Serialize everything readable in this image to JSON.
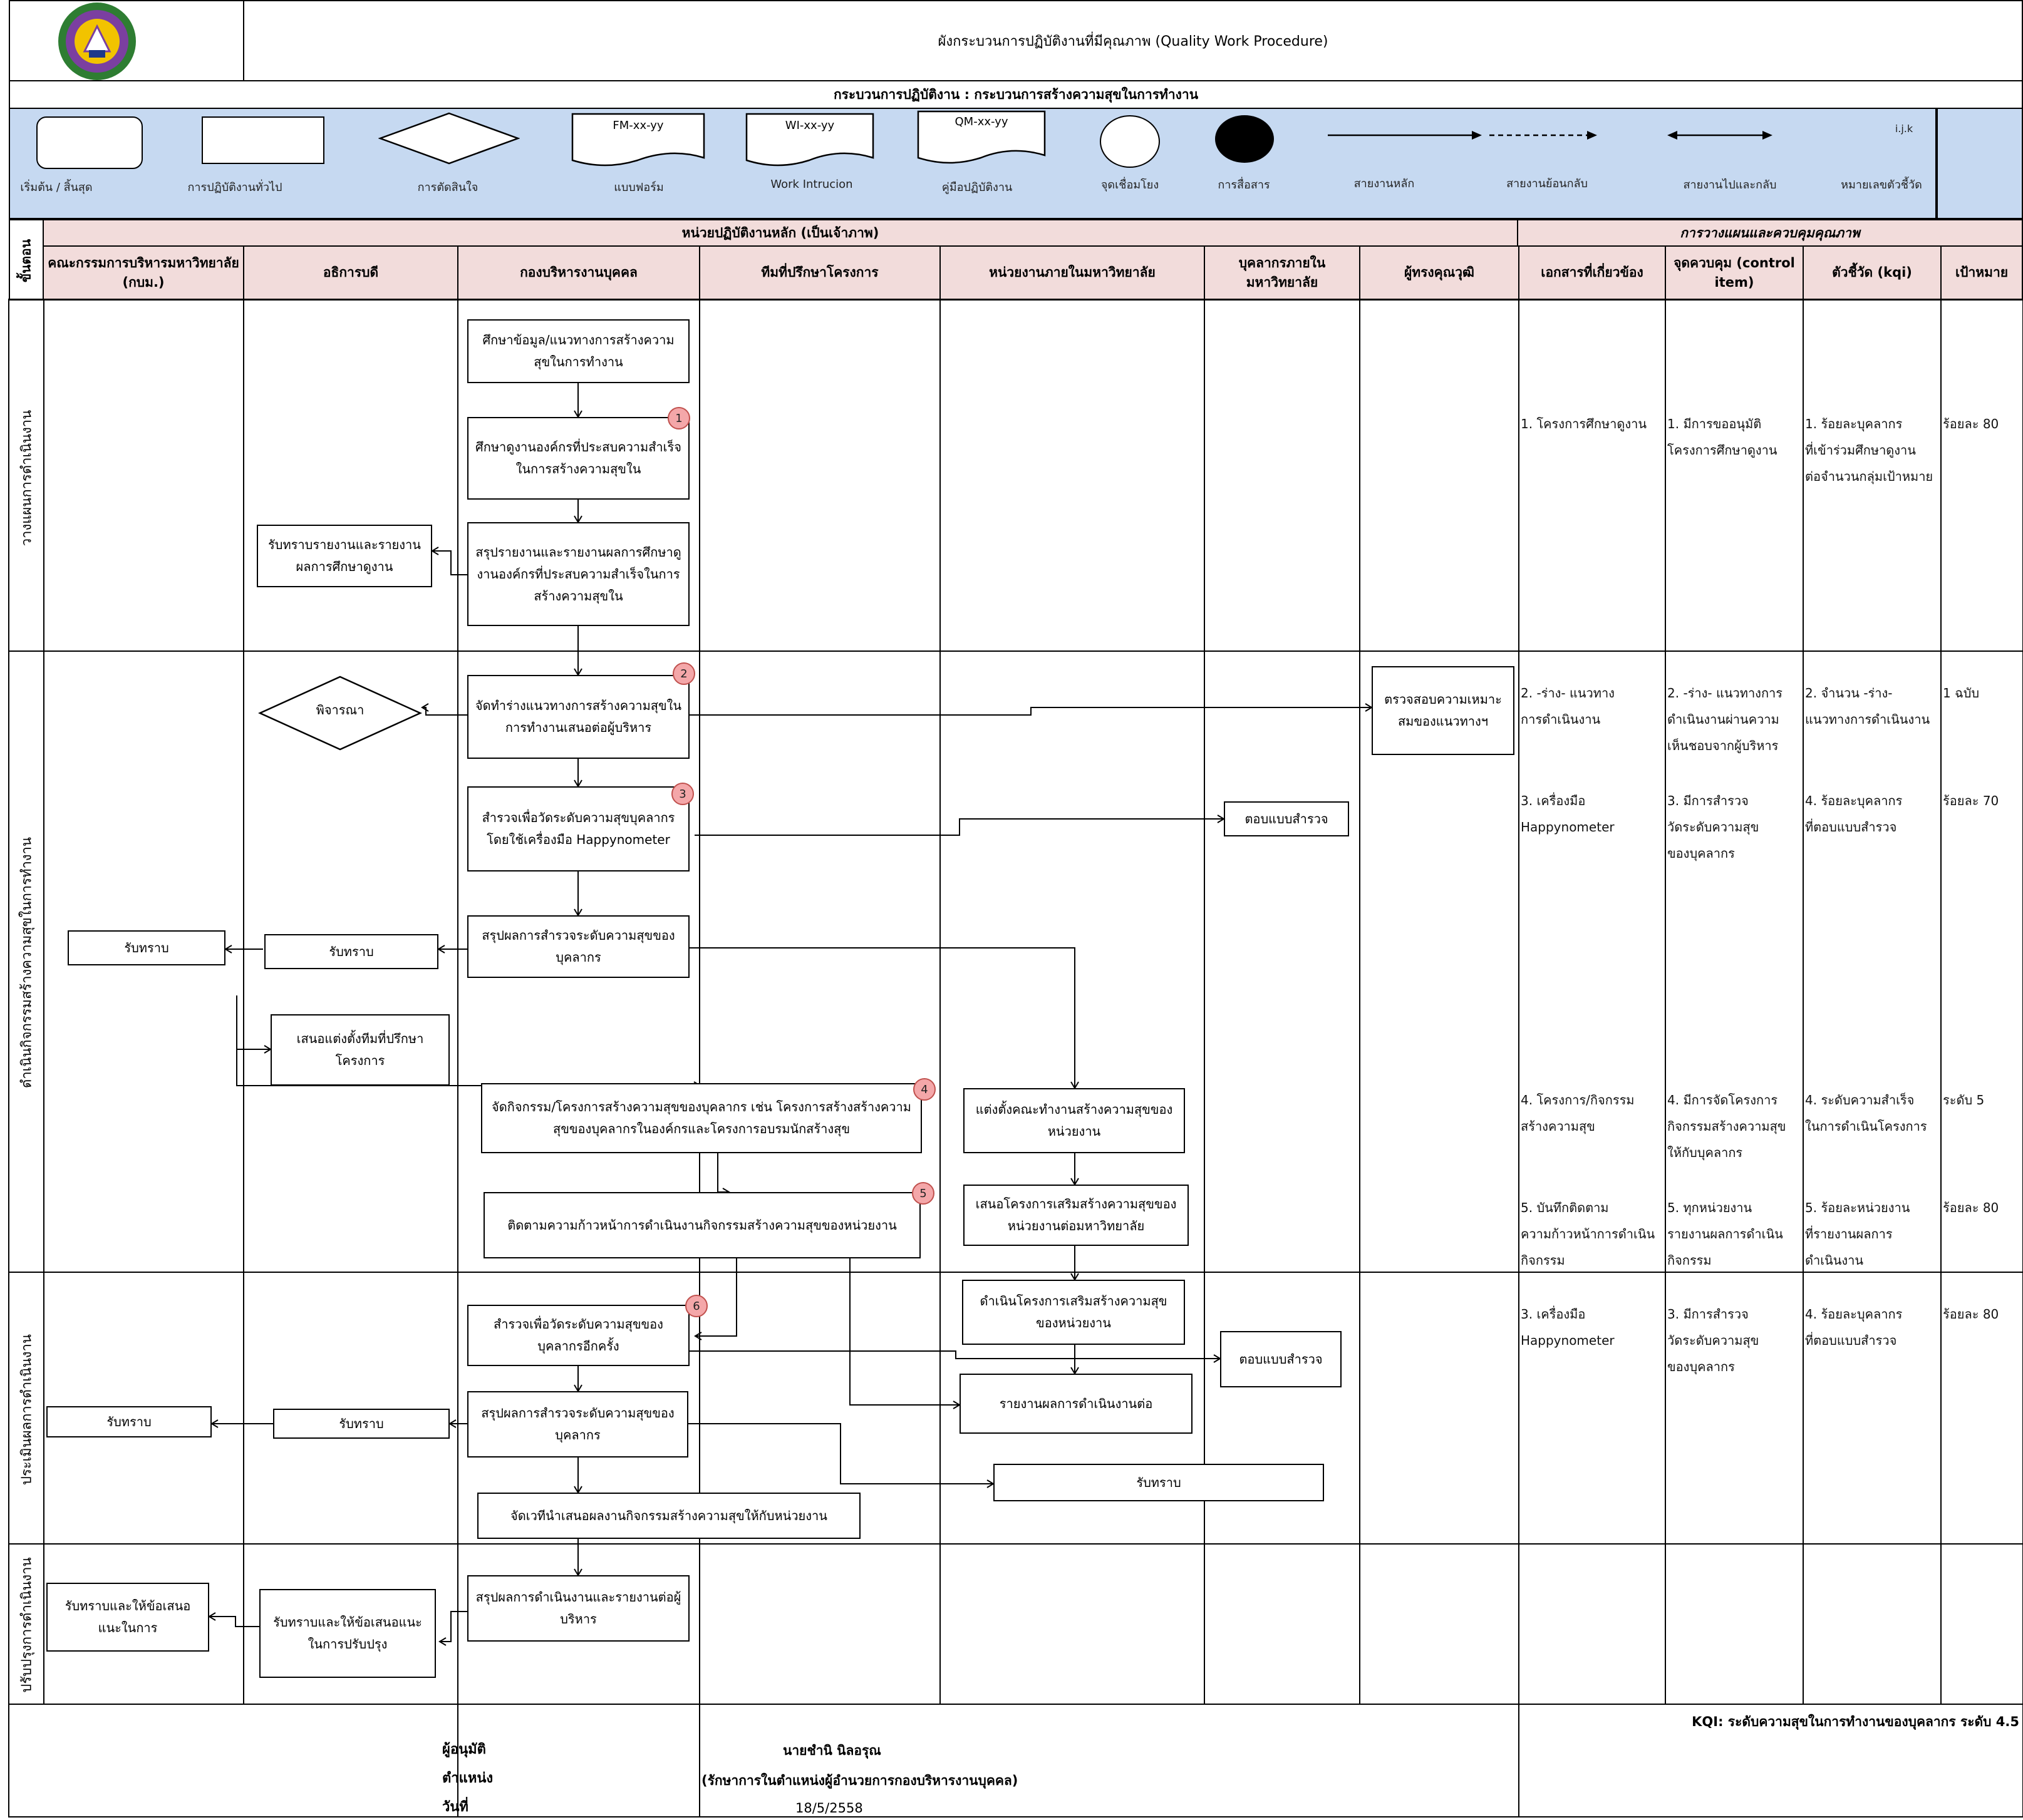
{
  "header": {
    "title": "ผังกระบวนการปฏิบัติงานที่มีคุณภาพ (Quality Work Procedure)",
    "process": "กระบวนการปฏิบัติงาน : กระบวนการสร้างความสุขในการทำงาน"
  },
  "legend": {
    "start_end": "เริ่มต้น / สิ้นสุด",
    "general": "การปฏิบัติงานทั่วไป",
    "decision": "การตัดสินใจ",
    "form": "แบบฟอร์ม",
    "form_code": "FM-xx-yy",
    "wi": "Work Intrucion",
    "wi_code": "WI-xx-yy",
    "manual": "คู่มือปฏิบัติงาน",
    "manual_code": "QM-xx-yy",
    "connector": "จุดเชื่อมโยง",
    "communication": "การสื่อสาร",
    "main_line": "สายงานหลัก",
    "return_line": "สายงานย้อนกลับ",
    "both_line": "สายงานไปและกลับ",
    "indicator": "หมายเลขตัวชี้วัด",
    "indicator_code": "i.j.k"
  },
  "table": {
    "step_head": "ขั้นตอน",
    "main_group": "หน่วยปฏิบัติงานหลัก (เป็นเจ้าภาพ)",
    "qc_group": "การวางแผนและควบคุมคุณภาพ",
    "columns": [
      "คณะกรรมการบริหารมหาวิทยาลัย (กบม.)",
      "อธิการบดี",
      "กองบริหารงานบุคคล",
      "ทีมที่ปรึกษาโครงการ",
      "หน่วยงานภายในมหาวิทยาลัย",
      "บุคลากรภายใน มหาวิทยาลัย",
      "ผู้ทรงคุณวุฒิ",
      "เอกสารที่เกี่ยวข้อง",
      "จุดควบคุม (control item)",
      "ตัวชี้วัด (kqi)",
      "เป้าหมาย"
    ],
    "phases": [
      "วางแผนการดำเนินงาน",
      "ดำเนินกิจกรรมสร้างความสุขในการทำงาน",
      "ประเมินผลการดำเนินงาน",
      "ปรับปรุงการดำเนินงาน"
    ]
  },
  "boxes": {
    "b1": "ศึกษาข้อมูล/แนวทางการสร้างความสุขในการทำงาน",
    "b2": "ศึกษาดูงานองค์กรที่ประสบความสำเร็จในการสร้างความสุขใน",
    "b3": "สรุปรายงานและรายงานผลการศึกษาดูงานองค์กรที่ประสบความสำเร็จในการสร้างความสุขใน",
    "b4": "รับทราบรายงานและรายงานผลการศึกษาดูงาน",
    "b5": "จัดทำร่างแนวทางการสร้างความสุขในการทำงานเสนอต่อผู้บริหาร",
    "b6": "พิจารณา",
    "b7": "ตรวจสอบความเหมาะสมของแนวทางฯ",
    "b8": "สำรวจเพื่อวัดระดับความสุขบุคลากรโดยใช้เครื่องมือ Happynometer",
    "b9": "ตอบแบบสำรวจ",
    "b10": "สรุปผลการสำรวจระดับความสุขของบุคลากร",
    "b11": "รับทราบ",
    "b12": "รับทราบ",
    "b13": "เสนอแต่งตั้งทีมที่ปรึกษาโครงการ",
    "b14": "จัดกิจกรรม/โครงการสร้างความสุขของบุคลากร เช่น โครงการสร้างสร้างความสุขของบุคลากรในองค์กรและโครงการอบรมนักสร้างสุข",
    "b15": "แต่งตั้งคณะทำงานสร้างความสุขของหน่วยงาน",
    "b16": "ติดตามความก้าวหน้าการดำเนินงานกิจกรรมสร้างความสุขของหน่วยงาน",
    "b17": "เสนอโครงการเสริมสร้างความสุขของหน่วยงานต่อมหาวิทยาลัย",
    "b18": "ดำเนินโครงการเสริมสร้างความสุขของหน่วยงาน",
    "b19": "สำรวจเพื่อวัดระดับความสุขของบุคลากรอีกครั้ง",
    "b20": "ตอบแบบสำรวจ",
    "b21": "รายงานผลการดำเนินงานต่อ",
    "b22": "สรุปผลการสำรวจระดับความสุขของบุคลากร",
    "b23": "รับทราบ",
    "b24": "รับทราบ",
    "b25": "รับทราบ",
    "b26": "จัดเวทีนำเสนอผลงานกิจกรรมสร้างความสุขให้กับหน่วยงาน",
    "b27": "สรุปผลการดำเนินงานและรายงานต่อผู้บริหาร",
    "b28": "รับทราบและให้ข้อเสนอแนะในการปรับปรุง",
    "b29": "รับทราบและให้ข้อเสนอแนะในการ"
  },
  "markers": [
    "1",
    "2",
    "3",
    "4",
    "5",
    "6"
  ],
  "quality_rows": [
    {
      "doc": "1. โครงการศึกษาดูงาน",
      "control": "1. มีการขออนุมัติ\nโครงการศึกษาดูงาน",
      "kqi": "1. ร้อยละบุคลากร\nที่เข้าร่วมศึกษาดูงาน\nต่อจำนวนกลุ่มเป้าหมาย",
      "target": "ร้อยละ 80"
    },
    {
      "doc": "2. -ร่าง- แนวทาง\nการดำเนินงาน",
      "control": "2. -ร่าง- แนวทางการ\nดำเนินงานผ่านความ\nเห็นชอบจากผู้บริหาร",
      "kqi": "2. จำนวน -ร่าง-\nแนวทางการดำเนินงาน",
      "target": "1 ฉบับ"
    },
    {
      "doc": "3. เครื่องมือ\nHappynometer",
      "control": "3. มีการสำรวจ\nวัดระดับความสุข\nของบุคลากร",
      "kqi": "4. ร้อยละบุคลากร\nที่ตอบแบบสำรวจ",
      "target": "ร้อยละ 70"
    },
    {
      "doc": "4. โครงการ/กิจกรรม\nสร้างความสุข",
      "control": "4. มีการจัดโครงการ\nกิจกรรมสร้างความสุข\nให้กับบุคลากร",
      "kqi": "4. ระดับความสำเร็จ\nในการดำเนินโครงการ",
      "target": "ระดับ 5"
    },
    {
      "doc": "5. บันทึกติดตาม\nความก้าวหน้าการดำเนิน\nกิจกรรม",
      "control": "5. ทุกหน่วยงาน\nรายงานผลการดำเนิน\nกิจกรรม",
      "kqi": "5. ร้อยละหน่วยงาน\nที่รายงานผลการ\nดำเนินงาน",
      "target": "ร้อยละ 80"
    },
    {
      "doc": "3. เครื่องมือ\nHappynometer",
      "control": "3. มีการสำรวจ\nวัดระดับความสุข\nของบุคลากร",
      "kqi": "4. ร้อยละบุคลากร\nที่ตอบแบบสำรวจ",
      "target": "ร้อยละ 80"
    }
  ],
  "kqi_summary": "KQI: ระดับความสุขในการทำงานของบุคลากร ระดับ 4.5",
  "footer": {
    "approver_label": "ผู้อนุมัติ",
    "approver_name": "นายชำนิ  นิลอรุณ",
    "position_label": "ตำแหน่ง",
    "position": "(รักษาการในตำแหน่งผู้อำนวยการกองบริหารงานบุคคล)",
    "date_label": "วันที่",
    "date": "18/5/2558"
  },
  "colors": {
    "legend_bg": "#c6d9f1",
    "header_bg": "#f2dcdb",
    "marker_fill": "#f4a7a9",
    "marker_border": "#c0504d"
  }
}
